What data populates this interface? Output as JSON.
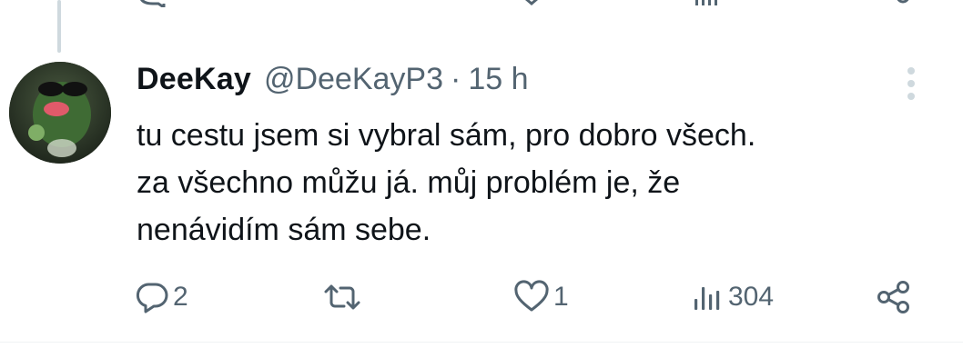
{
  "tweet": {
    "author_name": "DeeKay",
    "handle": "@DeeKayP3",
    "separator": "·",
    "time": "15 h",
    "text_lines": [
      "tu cestu jsem si vybral sám, pro dobro všech.",
      "za všechno můžu já. můj problém je, že",
      "nenávidím sám sebe."
    ],
    "actions": {
      "replies": "2",
      "reposts": "",
      "likes": "1",
      "views": "304"
    }
  },
  "icons": {
    "reply": "reply-icon",
    "repost": "repost-icon",
    "like": "heart-icon",
    "views": "views-icon",
    "share": "share-icon",
    "more": "more-icon"
  },
  "colors": {
    "text": "#0f1419",
    "secondary": "#536471",
    "thread_line": "#cfd9de"
  }
}
